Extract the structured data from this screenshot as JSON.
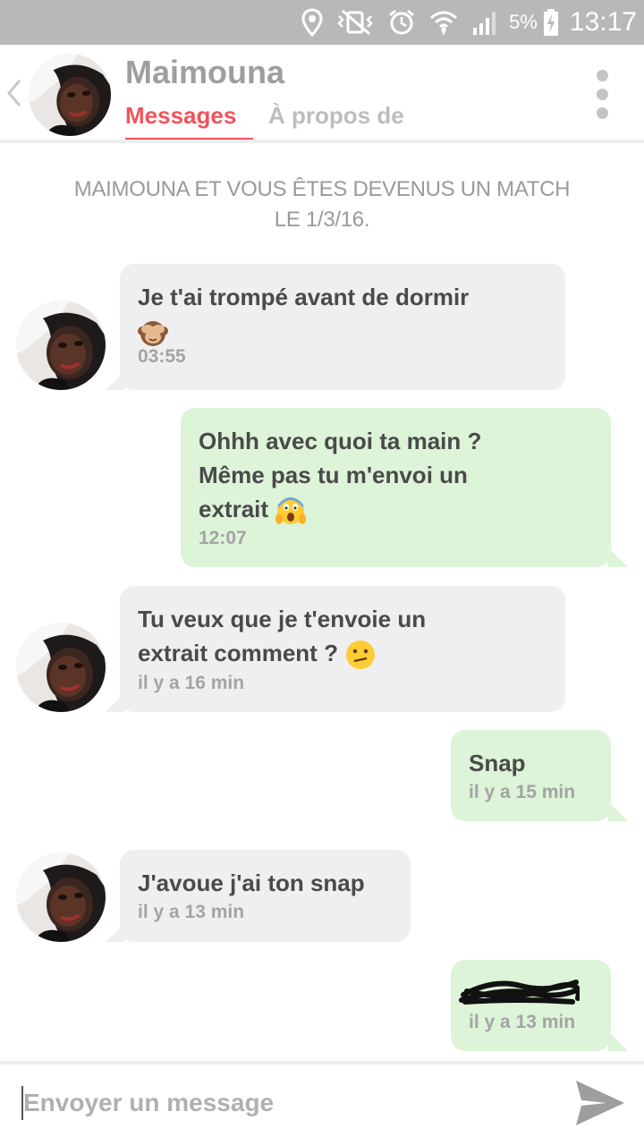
{
  "status_bar": {
    "battery": "5%",
    "time": "13:17",
    "icons": [
      "location-icon",
      "vibrate-mute-icon",
      "alarm-icon",
      "wifi-icon",
      "signal-icon",
      "battery-charging-icon"
    ]
  },
  "header": {
    "name": "Maimouna",
    "tabs": [
      "Messages",
      "À propos de"
    ],
    "active_tab": "Messages",
    "accent_color": "#f0545b"
  },
  "match_notice": {
    "line1": "MAIMOUNA ET VOUS ÊTES DEVENUS UN MATCH",
    "line2": "LE 1/3/16."
  },
  "messages": [
    {
      "direction": "in",
      "line1": "Je t'ai trompé avant de dormir",
      "emoji": "see-no-evil-monkey",
      "time": "03:55"
    },
    {
      "direction": "out",
      "line1": "Ohhh avec quoi ta main ?",
      "line2": "Même pas tu m'envoi un",
      "line3": "extrait",
      "emoji": "screaming-face",
      "time": "12:07"
    },
    {
      "direction": "in",
      "line1": "Tu veux que je t'envoie un",
      "line2": "extrait comment ?",
      "emoji": "confused-face",
      "time": "il y a 16 min"
    },
    {
      "direction": "out",
      "line1": "Snap",
      "time": "il y a 15 min"
    },
    {
      "direction": "in",
      "line1": "J'avoue j'ai ton snap",
      "time": "il y a 13 min"
    },
    {
      "direction": "out",
      "line1": "",
      "redacted": true,
      "time": "il y a 13 min"
    }
  ],
  "composer": {
    "placeholder": "Envoyer un message",
    "send_icon": "send-icon"
  },
  "colors": {
    "incoming_bubble": "#efefef",
    "outgoing_bubble": "#ddf4d8",
    "status_bar": "#b8b8b8"
  }
}
